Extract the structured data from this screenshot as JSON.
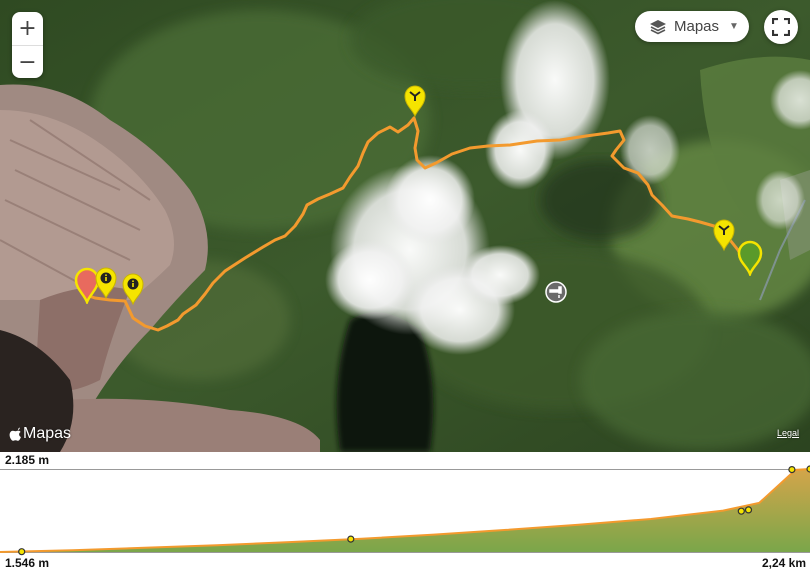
{
  "map": {
    "zoom_in_label": "+",
    "zoom_out_label": "−",
    "layer_button_label": "Mapas",
    "layer_icon": "layers-icon",
    "fullscreen_icon": "fullscreen-icon",
    "attribution_brand": "Mapas",
    "attribution_logo": "apple-logo-icon",
    "legal_link": "Legal",
    "route_color": "#f39a2e",
    "markers": [
      {
        "type": "start",
        "color": "#e86a5e",
        "icon": "pin-icon"
      },
      {
        "type": "info",
        "color": "#f5e400",
        "icon": "info-icon"
      },
      {
        "type": "info",
        "color": "#f5e400",
        "icon": "info-icon"
      },
      {
        "type": "junction",
        "color": "#f5e400",
        "icon": "fork-icon"
      },
      {
        "type": "junction",
        "color": "#f5e400",
        "icon": "fork-icon"
      },
      {
        "type": "end",
        "color": "#5a9a2a",
        "icon": "pin-icon"
      },
      {
        "type": "water",
        "color": "#666666",
        "icon": "water-tap-icon"
      }
    ]
  },
  "elevation_profile": {
    "max_label": "2.185 m",
    "min_label": "1.546 m",
    "distance_label": "2,24 km"
  },
  "chart_data": {
    "type": "area",
    "x": [
      0,
      0.2,
      0.4,
      0.6,
      0.8,
      1.0,
      1.2,
      1.4,
      1.6,
      1.8,
      2.0,
      2.1,
      2.2,
      2.24
    ],
    "y": [
      1546,
      1560,
      1578,
      1598,
      1622,
      1648,
      1680,
      1716,
      1756,
      1800,
      1865,
      1925,
      2178,
      2185
    ],
    "xlim": [
      0,
      2.24
    ],
    "ylim": [
      1546,
      2185
    ],
    "x_unit": "km",
    "y_unit": "m",
    "waypoints": [
      {
        "x": 0.06,
        "y": 1548
      },
      {
        "x": 0.97,
        "y": 1645
      },
      {
        "x": 2.05,
        "y": 1860
      },
      {
        "x": 2.07,
        "y": 1870
      },
      {
        "x": 2.19,
        "y": 2180
      },
      {
        "x": 2.24,
        "y": 2185
      }
    ],
    "fill_color": "#c9a24a",
    "line_color": "#f39a2e"
  }
}
